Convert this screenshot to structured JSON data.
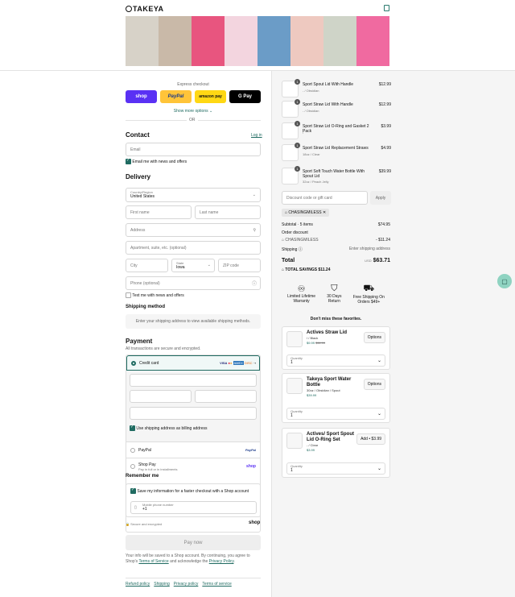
{
  "header": {
    "brand": "TAKEYA"
  },
  "banner": {
    "colors": [
      "#d7d2c8",
      "#c9b9a8",
      "#e8557f",
      "#f3d5df",
      "#6b9cc7",
      "#eec9c0",
      "#cfd4c8",
      "#f06aa0"
    ]
  },
  "express": {
    "label": "Express checkout",
    "shop": "shop",
    "paypal": "PayPal",
    "amazon": "amazon pay",
    "gpay": "G Pay",
    "more": "Show more options ⌄",
    "or": "OR"
  },
  "contact": {
    "title": "Contact",
    "login": "Log in",
    "email_ph": "Email",
    "news": "Email me with news and offers"
  },
  "delivery": {
    "title": "Delivery",
    "country_label": "Country/Region",
    "country": "United States",
    "first": "First name",
    "last": "Last name",
    "address": "Address",
    "apt": "Apartment, suite, etc. (optional)",
    "city": "City",
    "state_label": "State",
    "state": "Iowa",
    "zip": "ZIP code",
    "phone": "Phone (optional)",
    "text_news": "Text me with news and offers"
  },
  "shipping": {
    "title": "Shipping method",
    "msg": "Enter your shipping address to view available shipping methods."
  },
  "payment": {
    "title": "Payment",
    "sub": "All transactions are secure and encrypted.",
    "card": "Credit card",
    "billing": "Use shipping address as billing address",
    "paypal": "PayPal",
    "paypal_logo": "PayPal",
    "shoppay": "Shop Pay",
    "shoppay_sub": "Pay in full or in installments",
    "shop_logo": "shop"
  },
  "remember": {
    "title": "Remember me",
    "save": "Save my information for a faster checkout with a Shop account",
    "mobile_label": "Mobile phone number",
    "mobile": "+1",
    "secure": "Secure and encrypted",
    "shop": "shop"
  },
  "pay": {
    "label": "Pay now",
    "legal1": "Your info will be saved to a Shop account. By continuing, you agree to Shop's",
    "terms": "Terms of Service",
    "legal2": " and acknowledge the ",
    "privacy": "Privacy Policy",
    "legal3": "."
  },
  "footer": {
    "links": [
      "Refund policy",
      "Shipping",
      "Privacy policy",
      "Terms of service"
    ]
  },
  "cart": {
    "items": [
      {
        "qty": "1",
        "name": "Sport Spout Lid With Handle",
        "variant": "- / Obsidian",
        "price": "$12.99"
      },
      {
        "qty": "1",
        "name": "Sport Straw Lid With Handle",
        "variant": "- / Obsidian",
        "price": "$12.99"
      },
      {
        "qty": "1",
        "name": "Sport Straw Lid O-Ring and Gasket 2 Pack",
        "variant": "/",
        "price": "$3.99"
      },
      {
        "qty": "1",
        "name": "Sport Straw Lid Replacement Straws",
        "variant": "18oz / Clear",
        "price": "$4.99"
      },
      {
        "qty": "1",
        "name": "Sport Soft Touch Water Bottle With Spout Lid",
        "variant": "32oz / Peach Jelly",
        "price": "$39.99"
      }
    ],
    "discount_ph": "Discount code or gift card",
    "apply": "Apply",
    "code": "CHASINGMILESS"
  },
  "summary": {
    "subtotal_label": "Subtotal · 5 items",
    "subtotal": "$74.95",
    "od_label": "Order discount",
    "code": "CHASINGMILESS",
    "discount": "- $11.24",
    "ship_label": "Shipping",
    "ship_val": "Enter shipping address",
    "total_label": "Total",
    "currency": "USD",
    "total": "$63.71",
    "savings_label": "TOTAL SAVINGS",
    "savings": "$11.24"
  },
  "perks": [
    {
      "l1": "Limited Lifetime",
      "l2": "Warranty"
    },
    {
      "l1": "30 Days",
      "l2": "Return"
    },
    {
      "l1": "Free Shipping On",
      "l2": "Orders $49+"
    }
  ],
  "upsell": {
    "title": "Don't miss these favorites.",
    "items": [
      {
        "name": "Actives Straw Lid",
        "variant": "/ / Black",
        "price": "$9.99",
        "old": "$11.99",
        "btn": "Options",
        "qlabel": "Quantity",
        "q": "1"
      },
      {
        "name": "Takeya Sport Water Bottle",
        "variant": "30oz / Obsidian / Spout",
        "price": "$39.99",
        "old": "",
        "btn": "Options",
        "qlabel": "Quantity",
        "q": "1"
      },
      {
        "name": "Actives/ Sport Spout Lid O-Ring Set",
        "variant": "- / Clear",
        "price": "$3.99",
        "old": "",
        "btn": "Add • $3.99",
        "qlabel": "Quantity",
        "q": "1"
      }
    ]
  }
}
